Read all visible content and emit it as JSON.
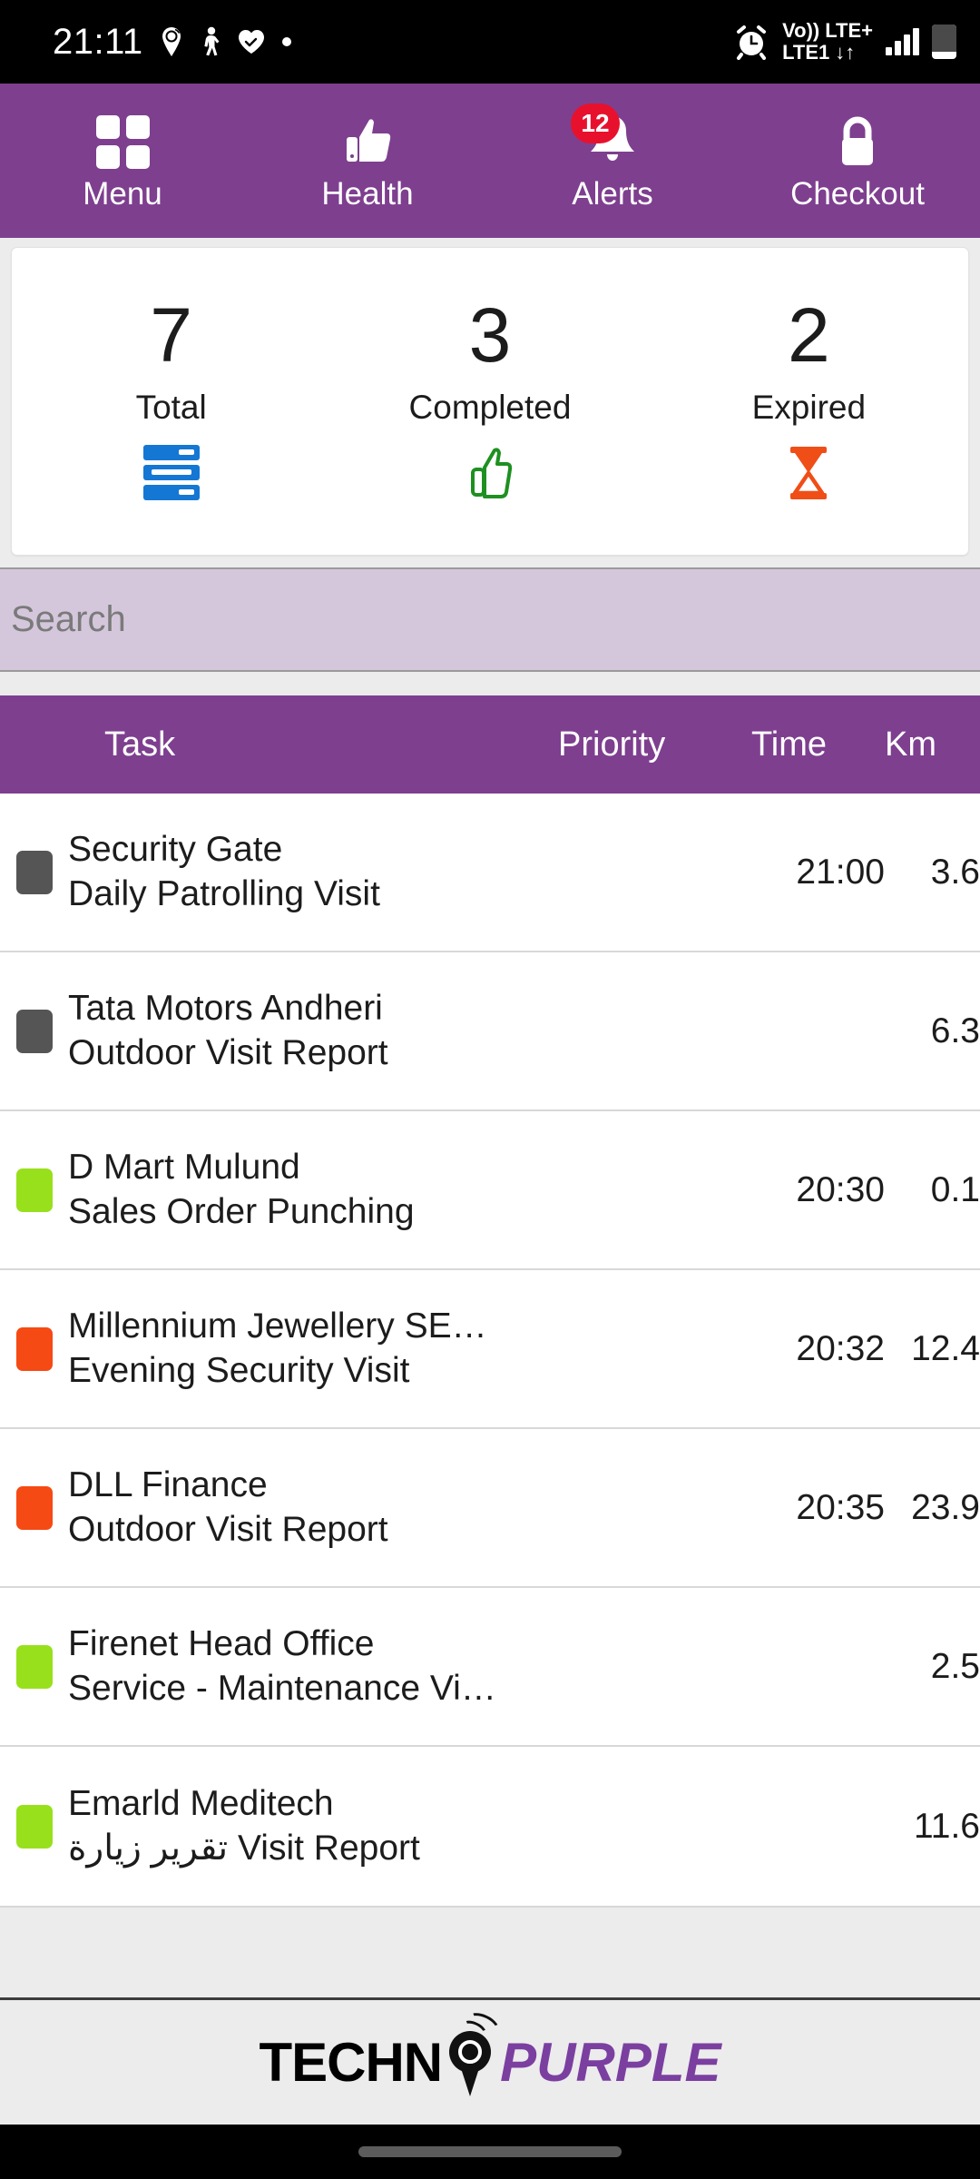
{
  "status_bar": {
    "time": "21:11",
    "left_icons": [
      "location-pin-icon",
      "person-walking-icon",
      "heart-check-icon",
      "dot-icon"
    ],
    "volte_line1": "Vo))",
    "lte_plus": "LTE+",
    "volte_line2": "LTE1",
    "data_arrows": "↓↑",
    "right_icons": [
      "alarm-clock-icon",
      "signal-bars-icon",
      "battery-icon"
    ]
  },
  "topnav": {
    "items": [
      {
        "label": "Menu",
        "icon": "grid-icon",
        "badge": ""
      },
      {
        "label": "Health",
        "icon": "thumbs-up-icon",
        "badge": ""
      },
      {
        "label": "Alerts",
        "icon": "bell-icon",
        "badge": "12"
      },
      {
        "label": "Checkout",
        "icon": "lock-icon",
        "badge": ""
      }
    ]
  },
  "stats": {
    "items": [
      {
        "value": "7",
        "label": "Total",
        "icon": "list-icon",
        "color": "#1577D4"
      },
      {
        "value": "3",
        "label": "Completed",
        "icon": "thumbs-up-icon",
        "color": "#1E9021"
      },
      {
        "value": "2",
        "label": "Expired",
        "icon": "hourglass-icon",
        "color": "#F04E17"
      }
    ]
  },
  "search": {
    "placeholder": "Search",
    "value": ""
  },
  "table": {
    "headers": {
      "task": "Task",
      "priority": "Priority",
      "time": "Time",
      "km": "Km"
    },
    "rows": [
      {
        "priority_color": "#555555",
        "title": "Security Gate",
        "subtitle": "Daily Patrolling Visit",
        "time": "21:00",
        "km": "3.6"
      },
      {
        "priority_color": "#555555",
        "title": "Tata Motors Andheri",
        "subtitle": "Outdoor Visit Report",
        "time": "",
        "km": "6.3"
      },
      {
        "priority_color": "#98E01C",
        "title": "D Mart Mulund",
        "subtitle": "Sales Order Punching",
        "time": "20:30",
        "km": "0.1"
      },
      {
        "priority_color": "#F54A14",
        "title": "Millennium Jewellery SE…",
        "subtitle": "Evening Security Visit",
        "time": "20:32",
        "km": "12.4"
      },
      {
        "priority_color": "#F54A14",
        "title": "DLL Finance",
        "subtitle": "Outdoor Visit Report",
        "time": "20:35",
        "km": "23.9"
      },
      {
        "priority_color": "#98E01C",
        "title": "Firenet Head Office",
        "subtitle": "Service - Maintenance Vi…",
        "time": "",
        "km": "2.5"
      },
      {
        "priority_color": "#98E01C",
        "title": "Emarld Meditech",
        "subtitle": "تقرير زيارة Visit Report",
        "time": "",
        "km": "11.6"
      }
    ]
  },
  "footer": {
    "logo_part1": "TECHN",
    "logo_part2": "PURPLE",
    "logo_mark": "location-pin-icon",
    "brand_color": "#7B3FA0"
  },
  "theme": {
    "purple": "#7E3F8F",
    "search_bg": "#D4C7DC",
    "page_bg": "#ECECEC",
    "badge_red": "#E8112D"
  }
}
